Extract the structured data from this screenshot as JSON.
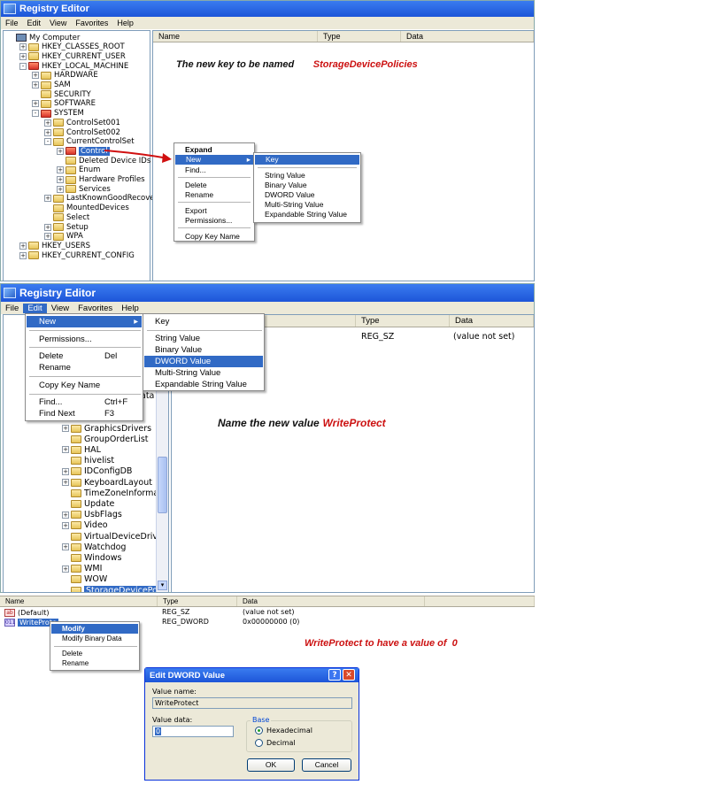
{
  "panel1": {
    "title": "Registry Editor",
    "menu": [
      "File",
      "Edit",
      "View",
      "Favorites",
      "Help"
    ],
    "columns": [
      "Name",
      "Type",
      "Data"
    ],
    "tree": [
      {
        "label": "My Computer",
        "pm": "",
        "icon": "pc"
      },
      {
        "label": "HKEY_CLASSES_ROOT",
        "pm": "+",
        "icon": "folder"
      },
      {
        "label": "HKEY_CURRENT_USER",
        "pm": "+",
        "icon": "folder"
      },
      {
        "label": "HKEY_LOCAL_MACHINE",
        "pm": "-",
        "icon": "red"
      },
      {
        "label": "HARDWARE",
        "pm": "+",
        "icon": "folder"
      },
      {
        "label": "SAM",
        "pm": "+",
        "icon": "folder"
      },
      {
        "label": "SECURITY",
        "pm": "",
        "icon": "folder"
      },
      {
        "label": "SOFTWARE",
        "pm": "+",
        "icon": "folder"
      },
      {
        "label": "SYSTEM",
        "pm": "-",
        "icon": "red"
      },
      {
        "label": "ControlSet001",
        "pm": "+",
        "icon": "folder"
      },
      {
        "label": "ControlSet002",
        "pm": "+",
        "icon": "folder"
      },
      {
        "label": "CurrentControlSet",
        "pm": "-",
        "icon": "folder"
      },
      {
        "label": "Control",
        "pm": "+",
        "icon": "red",
        "selected": true
      },
      {
        "label": "Deleted Device IDs",
        "pm": "",
        "icon": "folder"
      },
      {
        "label": "Enum",
        "pm": "+",
        "icon": "folder"
      },
      {
        "label": "Hardware Profiles",
        "pm": "+",
        "icon": "folder"
      },
      {
        "label": "Services",
        "pm": "+",
        "icon": "folder"
      },
      {
        "label": "LastKnownGoodRecovery",
        "pm": "+",
        "icon": "folder"
      },
      {
        "label": "MountedDevices",
        "pm": "",
        "icon": "folder"
      },
      {
        "label": "Select",
        "pm": "",
        "icon": "folder"
      },
      {
        "label": "Setup",
        "pm": "+",
        "icon": "folder"
      },
      {
        "label": "WPA",
        "pm": "+",
        "icon": "folder"
      },
      {
        "label": "HKEY_USERS",
        "pm": "+",
        "icon": "folder"
      },
      {
        "label": "HKEY_CURRENT_CONFIG",
        "pm": "+",
        "icon": "folder"
      }
    ],
    "annotation_prefix": "The new key to be named",
    "annotation_name": "StorageDevicePolicies",
    "context_menu": [
      "Expand",
      "New",
      "Find...",
      "Delete",
      "Rename",
      "Export",
      "Permissions...",
      "Copy Key Name"
    ],
    "submenu": [
      "Key",
      "String Value",
      "Binary Value",
      "DWORD Value",
      "Multi-String Value",
      "Expandable String Value"
    ]
  },
  "panel2": {
    "title": "Registry Editor",
    "menu": [
      "File",
      "Edit",
      "View",
      "Favorites",
      "Help"
    ],
    "edit_menu": [
      {
        "label": "New",
        "shortcut": ""
      },
      {
        "label": "Permissions...",
        "shortcut": ""
      },
      {
        "label": "Delete",
        "shortcut": "Del"
      },
      {
        "label": "Rename",
        "shortcut": ""
      },
      {
        "label": "Copy Key Name",
        "shortcut": ""
      },
      {
        "label": "Find...",
        "shortcut": "Ctrl+F"
      },
      {
        "label": "Find Next",
        "shortcut": "F3"
      }
    ],
    "new_submenu": [
      "Key",
      "String Value",
      "Binary Value",
      "DWORD Value",
      "Multi-String Value",
      "Expandable String Value"
    ],
    "columns": [
      "Type",
      "Data"
    ],
    "default_row": {
      "type": "REG_SZ",
      "data": "(value not set)"
    },
    "tree_partial_text": "ata",
    "tree": [
      {
        "label": "GraphicsDrivers",
        "pm": "+"
      },
      {
        "label": "GroupOrderList",
        "pm": ""
      },
      {
        "label": "HAL",
        "pm": "+"
      },
      {
        "label": "hivelist",
        "pm": ""
      },
      {
        "label": "IDConfigDB",
        "pm": "+"
      },
      {
        "label": "KeyboardLayout",
        "pm": "+"
      },
      {
        "label": "TimeZoneInforma",
        "pm": ""
      },
      {
        "label": "Update",
        "pm": ""
      },
      {
        "label": "UsbFlags",
        "pm": "+"
      },
      {
        "label": "Video",
        "pm": "+"
      },
      {
        "label": "VirtualDeviceDrive",
        "pm": ""
      },
      {
        "label": "Watchdog",
        "pm": "+"
      },
      {
        "label": "Windows",
        "pm": ""
      },
      {
        "label": "WMI",
        "pm": "+"
      },
      {
        "label": "WOW",
        "pm": ""
      },
      {
        "label": "StorageDevicePo",
        "pm": "",
        "selected": true
      }
    ],
    "annotation_prefix": "Name the new value",
    "annotation_name": "WriteProtect"
  },
  "panel3": {
    "columns": [
      "Name",
      "Type",
      "Data"
    ],
    "rows": [
      {
        "name": "(Default)",
        "type": "REG_SZ",
        "data": "(value not set)",
        "icon": "ab"
      },
      {
        "name": "WriteProte",
        "type": "REG_DWORD",
        "data": "0x00000000 (0)",
        "icon": "011",
        "selected": true
      }
    ],
    "context_menu": [
      "Modify",
      "Modify Binary Data",
      "Delete",
      "Rename"
    ],
    "annotation": "WriteProtect to have a value of  0"
  },
  "dialog": {
    "title": "Edit DWORD Value",
    "value_name_label": "Value name:",
    "value_name": "WriteProtect",
    "value_data_label": "Value data:",
    "value_data": "0",
    "base_label": "Base",
    "options": [
      "Hexadecimal",
      "Decimal"
    ],
    "selected_option": "Hexadecimal",
    "ok_label": "OK",
    "cancel_label": "Cancel",
    "help_glyph": "?",
    "close_glyph": "✕"
  }
}
